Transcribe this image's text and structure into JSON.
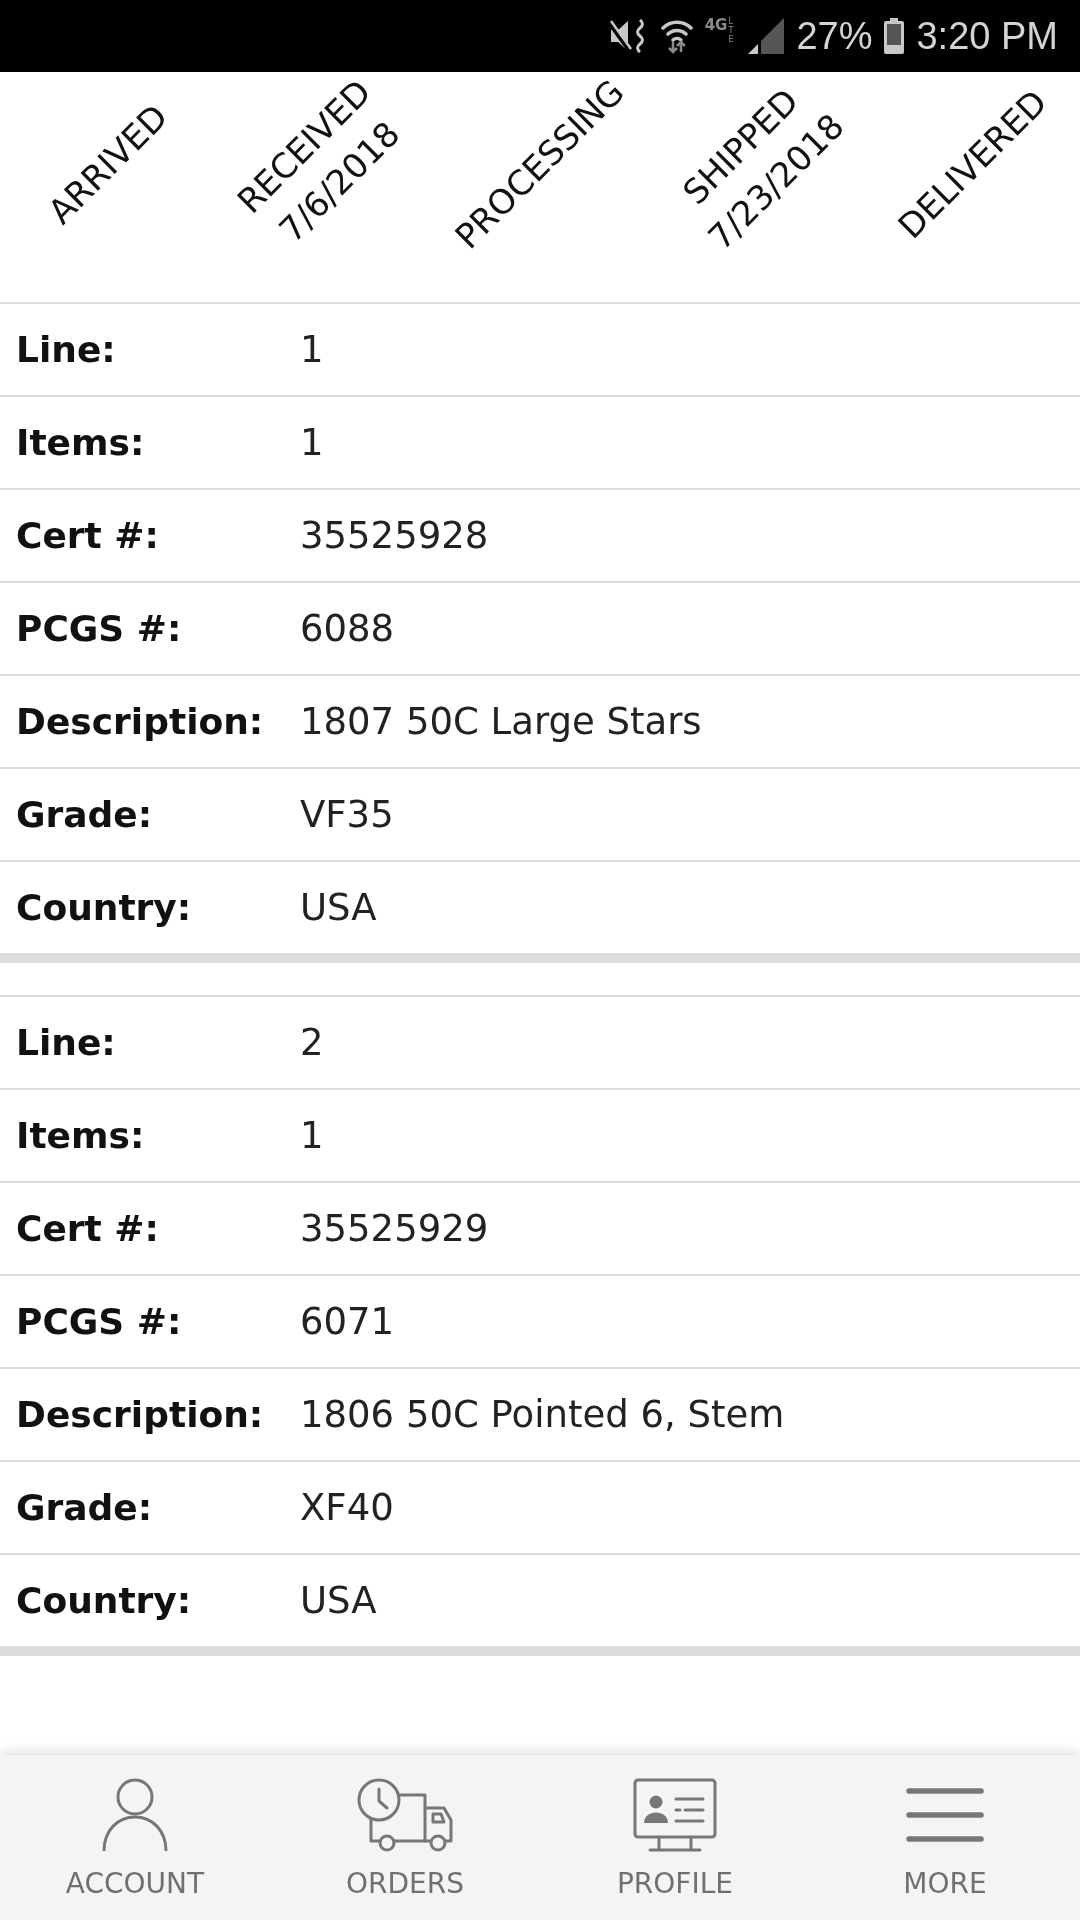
{
  "status_bar": {
    "network": "4G",
    "network_suffix": "LTE",
    "battery": "27%",
    "time": "3:20 PM"
  },
  "progress_steps": [
    {
      "label": "ARRIVED"
    },
    {
      "label": "RECEIVED",
      "date": "7/6/2018"
    },
    {
      "label": "PROCESSING"
    },
    {
      "label": "SHIPPED",
      "date": "7/23/2018"
    },
    {
      "label": "DELIVERED"
    }
  ],
  "order_lines": [
    {
      "fields": [
        {
          "label": "Line:",
          "value": "1"
        },
        {
          "label": "Items:",
          "value": "1"
        },
        {
          "label": "Cert #:",
          "value": "35525928"
        },
        {
          "label": "PCGS #:",
          "value": "6088"
        },
        {
          "label": "Description:",
          "value": "1807 50C Large Stars"
        },
        {
          "label": "Grade:",
          "value": "VF35"
        },
        {
          "label": "Country:",
          "value": "USA"
        }
      ]
    },
    {
      "fields": [
        {
          "label": "Line:",
          "value": "2"
        },
        {
          "label": "Items:",
          "value": "1"
        },
        {
          "label": "Cert #:",
          "value": "35525929"
        },
        {
          "label": "PCGS #:",
          "value": "6071"
        },
        {
          "label": "Description:",
          "value": "1806 50C Pointed 6, Stem"
        },
        {
          "label": "Grade:",
          "value": "XF40"
        },
        {
          "label": "Country:",
          "value": "USA"
        }
      ]
    }
  ],
  "bottom_nav": [
    {
      "label": "ACCOUNT"
    },
    {
      "label": "ORDERS"
    },
    {
      "label": "PROFILE"
    },
    {
      "label": "MORE"
    }
  ]
}
